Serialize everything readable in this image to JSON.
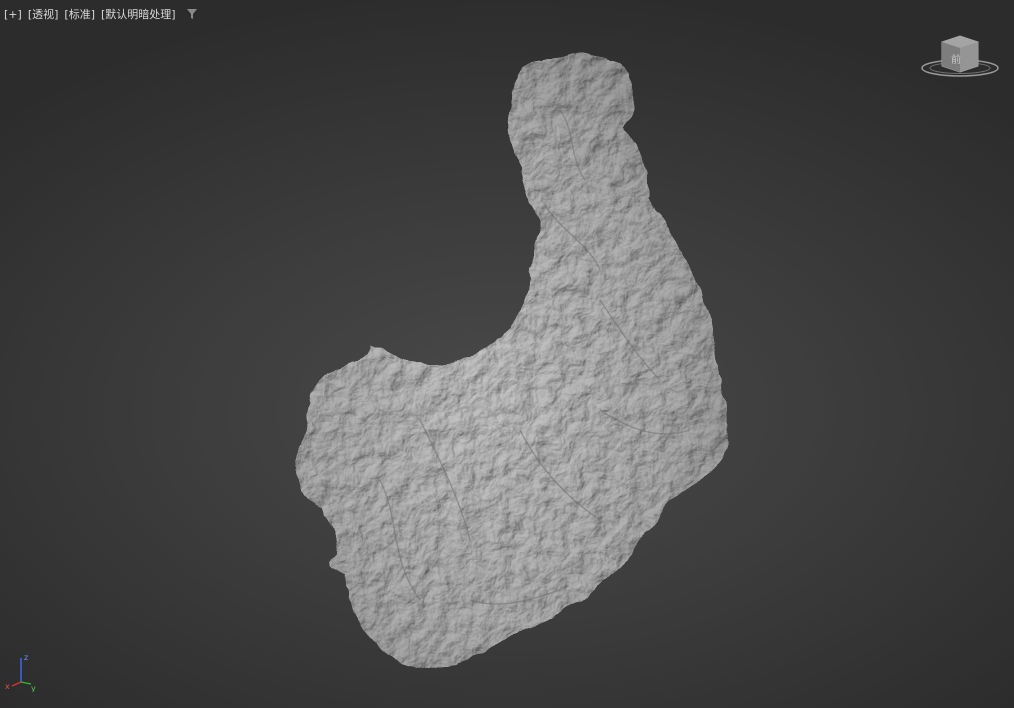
{
  "viewport": {
    "labels": {
      "plus": "[+]",
      "view": "[透视]",
      "shading": "[标准]",
      "lighting": "[默认明暗处理]"
    },
    "background_color": "#3c3c3c",
    "model_color": "#bdbdbd"
  },
  "viewcube": {
    "face_label": "前"
  },
  "axis_tripod": {
    "x_label": "x",
    "y_label": "y",
    "z_label": "z",
    "x_color": "#e03030",
    "y_color": "#2fbf2f",
    "z_color": "#3a6cff"
  },
  "icons": {
    "filter": "filter-icon",
    "viewcube": "viewcube-icon",
    "axis": "axis-tripod-icon"
  }
}
